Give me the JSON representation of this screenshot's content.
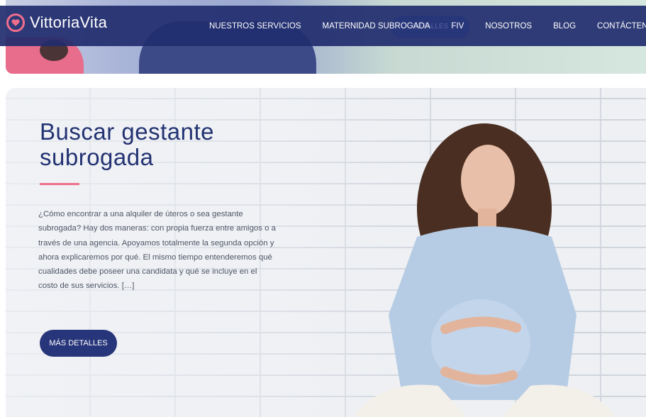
{
  "header": {
    "logo_text": "VittoriaVita",
    "nav": [
      {
        "label": "NUESTROS SERVICIOS"
      },
      {
        "label": "MATERNIDAD SUBROGADA"
      },
      {
        "label": "FIV"
      },
      {
        "label": "NOSOTROS"
      },
      {
        "label": "BLOG"
      },
      {
        "label": "CONTÁCTENOS"
      }
    ],
    "ghost_button_label": "DETALLES"
  },
  "article": {
    "title": "Buscar gestante subrogada",
    "excerpt": "¿Cómo encontrar a una alquiler de úteros o sea gestante subrogada? Hay dos maneras: con propia fuerza entre amigos o a través de una agencia. Apoyamos totalmente la segunda opción y ahora explicaremos por qué. El mismo tiempo entenderemos qué cualidades debe poseer una candidata y qué se incluye en el costo de sus servicios. […]",
    "cta_label": "MÁS DETALLES"
  },
  "colors": {
    "header_bg": "#212d6e",
    "accent_pink": "#ef6f8b",
    "title_navy": "#233372",
    "button_bg": "#27357a"
  },
  "icons": {
    "logo": "heart-circle-icon"
  }
}
